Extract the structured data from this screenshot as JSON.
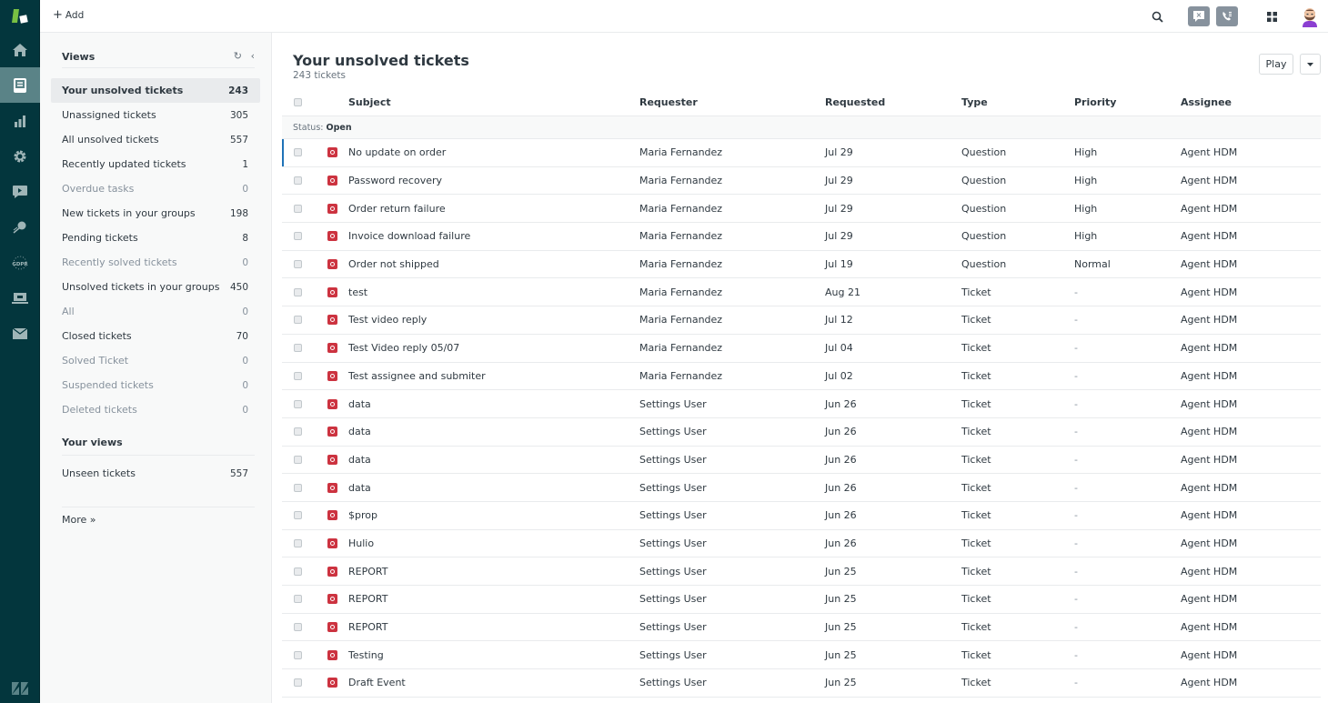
{
  "topbar": {
    "add_label": "Add"
  },
  "rail": {
    "items": [
      {
        "name": "home",
        "icon": "home-icon"
      },
      {
        "name": "views",
        "icon": "views-icon",
        "active": true
      },
      {
        "name": "reporting",
        "icon": "bar-chart-icon"
      },
      {
        "name": "admin",
        "icon": "gear-icon"
      },
      {
        "name": "chat",
        "icon": "chat-icon"
      },
      {
        "name": "explore",
        "icon": "explore-icon"
      },
      {
        "name": "gdpr",
        "icon": "gdpr-icon"
      },
      {
        "name": "laptop",
        "icon": "laptop-icon"
      },
      {
        "name": "mail",
        "icon": "mail-icon"
      }
    ]
  },
  "views": {
    "title": "Views",
    "items": [
      {
        "label": "Your unsolved tickets",
        "count": "243",
        "active": true,
        "muted": false
      },
      {
        "label": "Unassigned tickets",
        "count": "305",
        "muted": false
      },
      {
        "label": "All unsolved tickets",
        "count": "557",
        "muted": false
      },
      {
        "label": "Recently updated tickets",
        "count": "1",
        "muted": false
      },
      {
        "label": "Overdue tasks",
        "count": "0",
        "muted": true
      },
      {
        "label": "New tickets in your groups",
        "count": "198",
        "muted": false
      },
      {
        "label": "Pending tickets",
        "count": "8",
        "muted": false
      },
      {
        "label": "Recently solved tickets",
        "count": "0",
        "muted": true
      },
      {
        "label": "Unsolved tickets in your groups",
        "count": "450",
        "muted": false
      },
      {
        "label": "All",
        "count": "0",
        "muted": true
      },
      {
        "label": "Closed tickets",
        "count": "70",
        "muted": false
      },
      {
        "label": "Solved Ticket",
        "count": "0",
        "muted": true
      },
      {
        "label": "Suspended tickets",
        "count": "0",
        "muted": true
      },
      {
        "label": "Deleted tickets",
        "count": "0",
        "muted": true
      }
    ],
    "your_views_title": "Your views",
    "your_views": [
      {
        "label": "Unseen tickets",
        "count": "557"
      }
    ],
    "more_label": "More »"
  },
  "main": {
    "title": "Your unsolved tickets",
    "subtitle": "243 tickets",
    "play_label": "Play",
    "columns": {
      "subject": "Subject",
      "requester": "Requester",
      "requested": "Requested",
      "type": "Type",
      "priority": "Priority",
      "assignee": "Assignee"
    },
    "group_prefix": "Status:",
    "group_value": "Open",
    "status_color": "#cc3340",
    "rows": [
      {
        "subject": "No update on order",
        "requester": "Maria Fernandez",
        "requested": "Jul 29",
        "type": "Question",
        "priority": "High",
        "assignee": "Agent HDM"
      },
      {
        "subject": "Password recovery",
        "requester": "Maria Fernandez",
        "requested": "Jul 29",
        "type": "Question",
        "priority": "High",
        "assignee": "Agent HDM"
      },
      {
        "subject": "Order return failure",
        "requester": "Maria Fernandez",
        "requested": "Jul 29",
        "type": "Question",
        "priority": "High",
        "assignee": "Agent HDM"
      },
      {
        "subject": "Invoice download failure",
        "requester": "Maria Fernandez",
        "requested": "Jul 29",
        "type": "Question",
        "priority": "High",
        "assignee": "Agent HDM"
      },
      {
        "subject": "Order not shipped",
        "requester": "Maria Fernandez",
        "requested": "Jul 19",
        "type": "Question",
        "priority": "Normal",
        "assignee": "Agent HDM"
      },
      {
        "subject": "test",
        "requester": "Maria Fernandez",
        "requested": "Aug 21",
        "type": "Ticket",
        "priority": "-",
        "assignee": "Agent HDM"
      },
      {
        "subject": "Test video reply",
        "requester": "Maria Fernandez",
        "requested": "Jul 12",
        "type": "Ticket",
        "priority": "-",
        "assignee": "Agent HDM"
      },
      {
        "subject": "Test Video reply 05/07",
        "requester": "Maria Fernandez",
        "requested": "Jul 04",
        "type": "Ticket",
        "priority": "-",
        "assignee": "Agent HDM"
      },
      {
        "subject": "Test assignee and submiter",
        "requester": "Maria Fernandez",
        "requested": "Jul 02",
        "type": "Ticket",
        "priority": "-",
        "assignee": "Agent HDM"
      },
      {
        "subject": "data",
        "requester": "Settings User",
        "requested": "Jun 26",
        "type": "Ticket",
        "priority": "-",
        "assignee": "Agent HDM"
      },
      {
        "subject": "data",
        "requester": "Settings User",
        "requested": "Jun 26",
        "type": "Ticket",
        "priority": "-",
        "assignee": "Agent HDM"
      },
      {
        "subject": "data",
        "requester": "Settings User",
        "requested": "Jun 26",
        "type": "Ticket",
        "priority": "-",
        "assignee": "Agent HDM"
      },
      {
        "subject": "data",
        "requester": "Settings User",
        "requested": "Jun 26",
        "type": "Ticket",
        "priority": "-",
        "assignee": "Agent HDM"
      },
      {
        "subject": "$prop",
        "requester": "Settings User",
        "requested": "Jun 26",
        "type": "Ticket",
        "priority": "-",
        "assignee": "Agent HDM"
      },
      {
        "subject": "Hulio",
        "requester": "Settings User",
        "requested": "Jun 26",
        "type": "Ticket",
        "priority": "-",
        "assignee": "Agent HDM"
      },
      {
        "subject": "REPORT",
        "requester": "Settings User",
        "requested": "Jun 25",
        "type": "Ticket",
        "priority": "-",
        "assignee": "Agent HDM"
      },
      {
        "subject": "REPORT",
        "requester": "Settings User",
        "requested": "Jun 25",
        "type": "Ticket",
        "priority": "-",
        "assignee": "Agent HDM"
      },
      {
        "subject": "REPORT",
        "requester": "Settings User",
        "requested": "Jun 25",
        "type": "Ticket",
        "priority": "-",
        "assignee": "Agent HDM"
      },
      {
        "subject": "Testing",
        "requester": "Settings User",
        "requested": "Jun 25",
        "type": "Ticket",
        "priority": "-",
        "assignee": "Agent HDM"
      },
      {
        "subject": "Draft Event",
        "requester": "Settings User",
        "requested": "Jun 25",
        "type": "Ticket",
        "priority": "-",
        "assignee": "Agent HDM"
      }
    ]
  }
}
